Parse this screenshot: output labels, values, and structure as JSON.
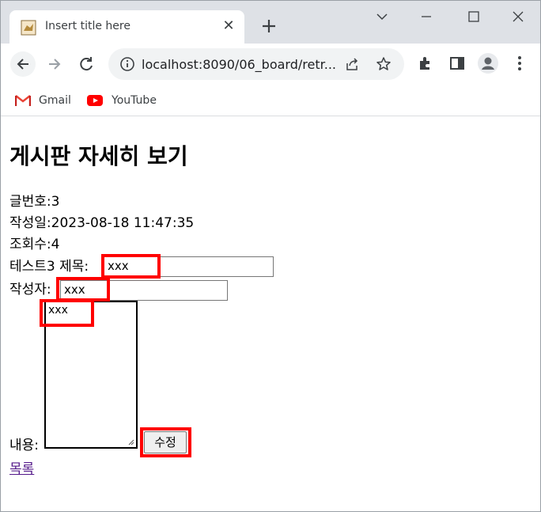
{
  "browser": {
    "tab_title": "Insert title here",
    "url": "localhost:8090/06_board/retr...",
    "bookmarks": [
      {
        "label": "Gmail"
      },
      {
        "label": "YouTube"
      }
    ]
  },
  "page": {
    "heading": "게시판 자세히 보기",
    "article_no_label": "글번호:",
    "article_no": "3",
    "date_label": "작성일:",
    "date": "2023-08-18 11:47:35",
    "views_label": "조회수:",
    "views": "4",
    "title_prefix": "테스트3",
    "title_label": " 제목:",
    "title_value": "xxx",
    "writer_label": "작성자:",
    "writer_value": "xxx",
    "content_value": "xxx",
    "content_label": "내용:",
    "submit_label": "수정",
    "list_link": "목록"
  },
  "colors": {
    "highlight": "#ff0000",
    "link_visited": "#551a8b"
  }
}
